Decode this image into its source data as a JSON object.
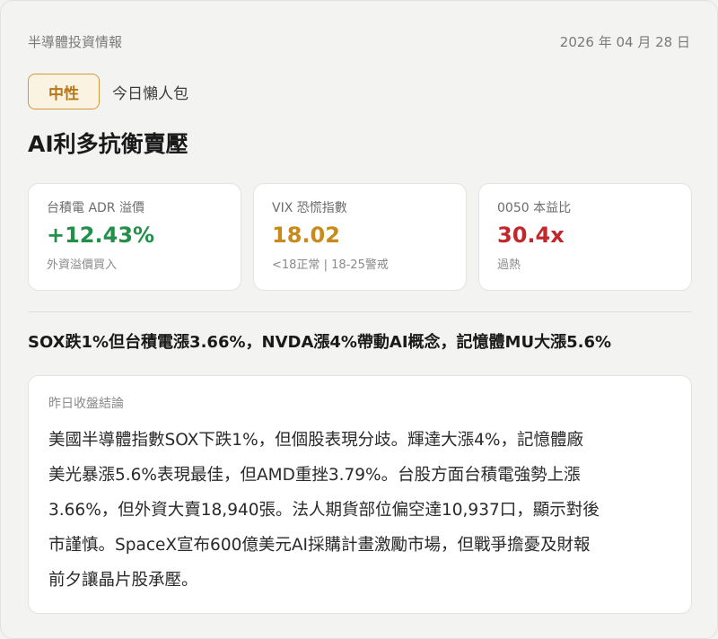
{
  "header": {
    "source": "半導體投資情報",
    "date": "2026 年 04 月 28 日"
  },
  "tag": {
    "sentiment": "中性",
    "subtitle": "今日懶人包"
  },
  "title": "AI利多抗衡賣壓",
  "metrics": [
    {
      "label": "台積電 ADR 溢價",
      "value": "+12.43%",
      "note": "外資溢價買入",
      "color": "#23904a"
    },
    {
      "label": "VIX 恐慌指數",
      "value": "18.02",
      "note": "<18正常 | 18-25警戒",
      "color": "#c88a1a"
    },
    {
      "label": "0050 本益比",
      "value": "30.4x",
      "note": "過熱",
      "color": "#c0282c"
    }
  ],
  "headline": "SOX跌1%但台積電漲3.66%，NVDA漲4%帶動AI概念，記憶體MU大漲5.6%",
  "summary": {
    "label": "昨日收盤結論",
    "lines": [
      "美國半導體指數SOX下跌1%，但個股表現分歧。輝達大漲4%，記憶體廠",
      "美光暴漲5.6%表現最佳，但AMD重挫3.79%。台股方面台積電強勢上漲",
      "3.66%，但外資大賣18,940張。法人期貨部位偏空達10,937口，顯示對後",
      "市謹慎。SpaceX宣布600億美元AI採購計畫激勵市場，但戰爭擔憂及財報",
      "前夕讓晶片股承壓。"
    ]
  }
}
